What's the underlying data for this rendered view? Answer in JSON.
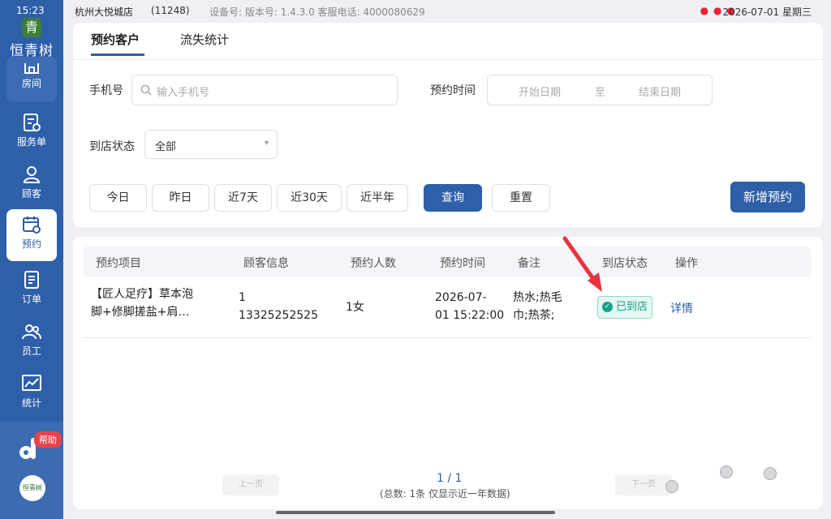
{
  "status_bar": {
    "time": "15:23",
    "day": "7月1",
    "store_name": "杭州大悦城店",
    "store_id": "(11248)",
    "device_info": "设备号: 版本号: 1.4.3.0 客服电话: 4000080629",
    "datetime": "2026-07-01 星期三"
  },
  "sidebar": {
    "logo_char": "青",
    "logo_text": "恒青树",
    "items": [
      {
        "label": "房间",
        "icon": "rooms-icon"
      },
      {
        "label": "服务单",
        "icon": "service-order-icon"
      },
      {
        "label": "顾客",
        "icon": "customer-icon"
      },
      {
        "label": "预约",
        "icon": "calendar-icon"
      },
      {
        "label": "订单",
        "icon": "order-icon"
      },
      {
        "label": "员工",
        "icon": "staff-icon"
      },
      {
        "label": "统计",
        "icon": "chart-icon"
      }
    ],
    "help_badge": "帮助",
    "avatar_text": "恒青树"
  },
  "tabs": [
    {
      "label": "预约客户",
      "active": true
    },
    {
      "label": "流失统计",
      "active": false
    }
  ],
  "filters": {
    "phone_label": "手机号",
    "phone_placeholder": "输入手机号",
    "time_label": "预约时间",
    "start_placeholder": "开始日期",
    "range_sep": "至",
    "end_placeholder": "结束日期",
    "status_label": "到店状态",
    "status_value": "全部"
  },
  "quick_buttons": [
    "今日",
    "昨日",
    "近7天",
    "近30天",
    "近半年"
  ],
  "actions": {
    "query": "查询",
    "reset": "重置",
    "new_booking": "新增预约"
  },
  "table": {
    "columns": [
      "预约项目",
      "顾客信息",
      "预约人数",
      "预约时间",
      "备注",
      "到店状态",
      "操作"
    ],
    "rows": [
      {
        "project_line1": "【匠人足疗】草本泡",
        "project_line2": "脚+修脚搓盐+肩…",
        "customer_line1": "1",
        "customer_line2": "13325252525",
        "people": "1女",
        "time_line1": "2026-07-",
        "time_line2": "01 15:22:00",
        "note_line1": "热水;热毛",
        "note_line2": "巾;热茶;",
        "status": "已到店",
        "action": "详情"
      }
    ]
  },
  "pagination": {
    "prev": "上一页",
    "next": "下一页",
    "page": "1 / 1",
    "summary": "(总数: 1条 仅显示近一年数据)"
  },
  "colors": {
    "primary": "#2e5fa9",
    "success": "#16a085",
    "annotation_arrow": "#e8343f"
  }
}
